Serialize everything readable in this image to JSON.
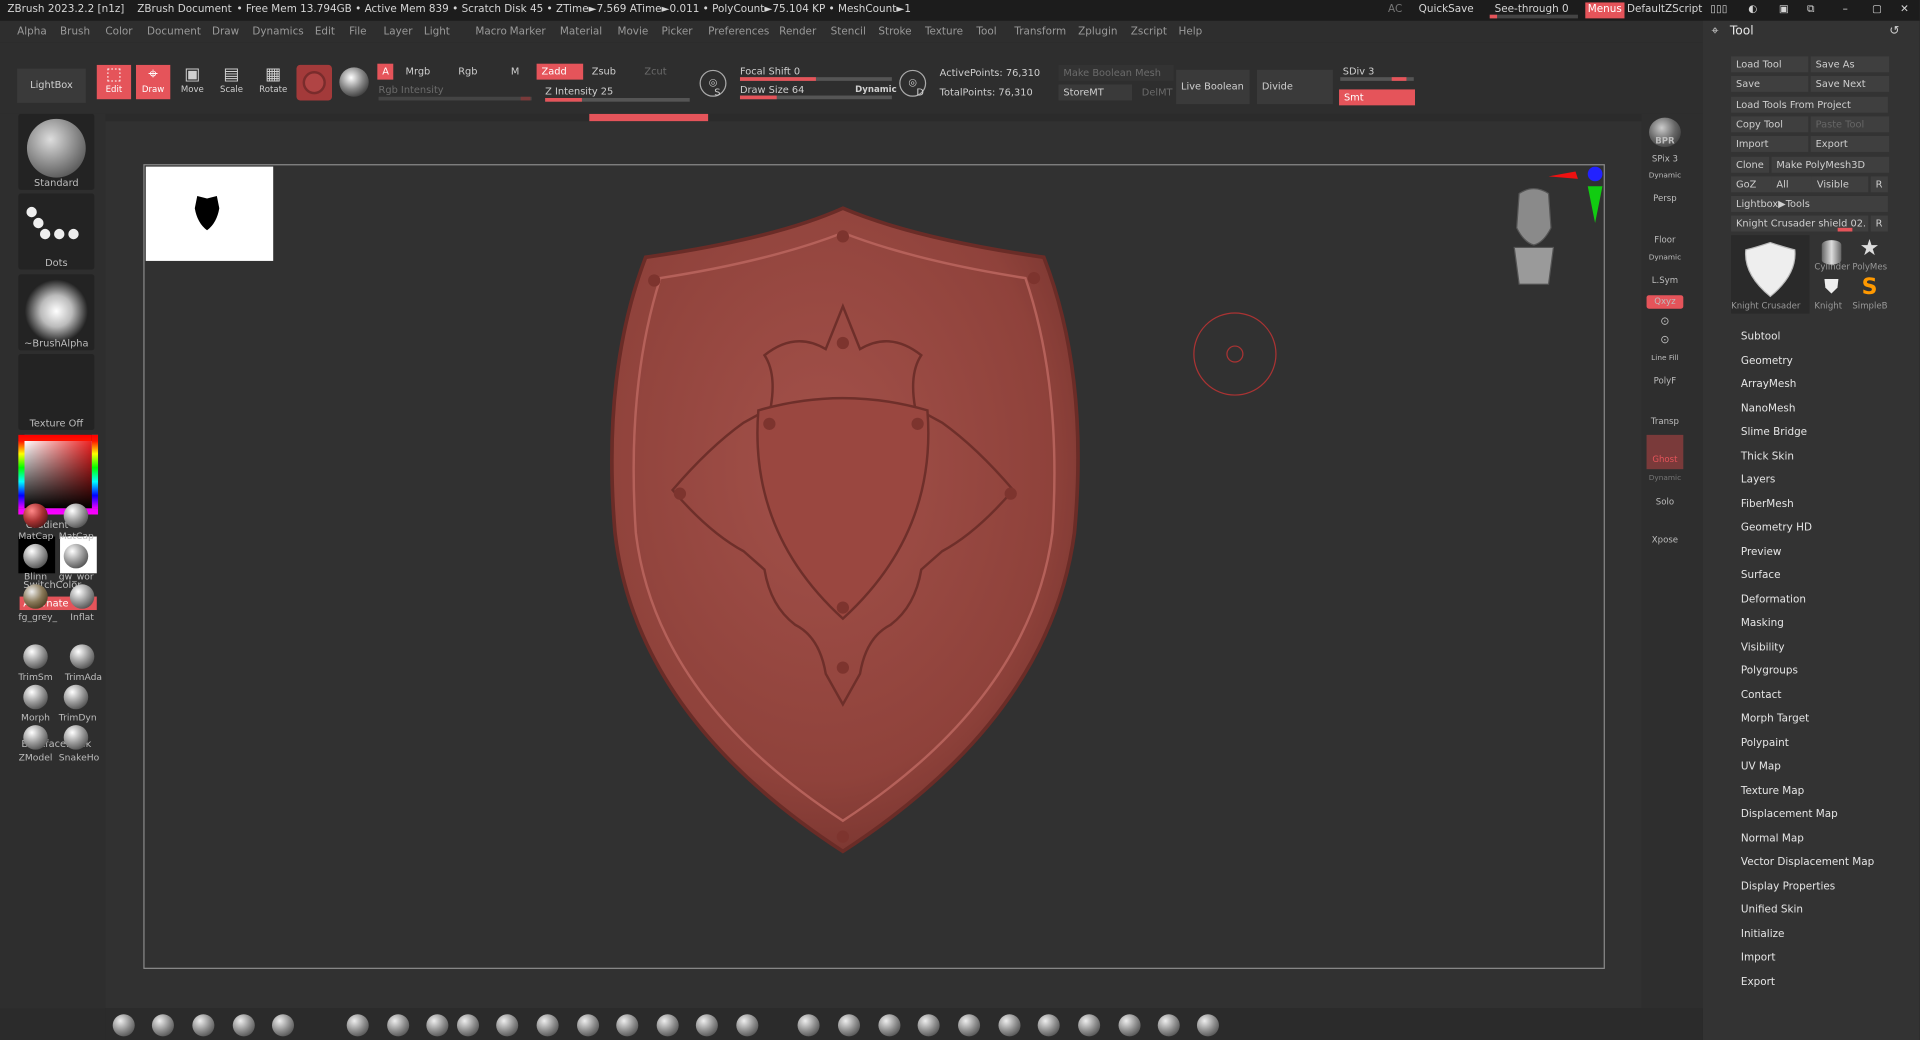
{
  "titlebar": {
    "app": "ZBrush 2023.2.2 [n1z]",
    "doc": "ZBrush Document",
    "stats": "• Free Mem 13.794GB • Active Mem 839 • Scratch Disk 45 • ZTime►7.569 ATime►0.011 • PolyCount►75.104 KP • MeshCount►1",
    "ac": "AC",
    "quicksave": "QuickSave",
    "seethrough": "See-through  0",
    "seethrough_value": 0,
    "menus": "Menus",
    "zscript": "DefaultZScript"
  },
  "menu": [
    "Alpha",
    "Brush",
    "Color",
    "Document",
    "Draw",
    "Dynamics",
    "Edit",
    "File",
    "Layer",
    "Light",
    "Macro",
    "Marker",
    "Material",
    "Movie",
    "Picker",
    "Preferences",
    "Render",
    "Stencil",
    "Stroke",
    "Texture",
    "Tool",
    "Transform",
    "Zplugin",
    "Zscript",
    "Help"
  ],
  "toolbar": {
    "lightbox": "LightBox",
    "edit": "Edit",
    "draw": "Draw",
    "move": "Move",
    "scale": "Scale",
    "rotate": "Rotate",
    "a": "A",
    "mrgb": "Mrgb",
    "rgb": "Rgb",
    "m": "M",
    "rgb_intensity": "Rgb Intensity",
    "zadd": "Zadd",
    "zsub": "Zsub",
    "zcut": "Zcut",
    "z_intensity": "Z Intensity 25",
    "z_intensity_value": 25,
    "focal_shift": "Focal Shift 0",
    "focal_shift_value": 0,
    "draw_size": "Draw Size 64",
    "draw_size_value": 64,
    "dynamic": "Dynamic",
    "active_points": "ActivePoints: 76,310",
    "total_points": "TotalPoints: 76,310",
    "make_boolean_mesh": "Make Boolean Mesh",
    "storemt": "StoreMT",
    "delmt": "DelMT",
    "live_boolean": "Live Boolean",
    "divide": "Divide",
    "sdiv": "SDiv 3",
    "sdiv_value": 3,
    "smt": "Smt",
    "s_key": "S",
    "d_key": "D"
  },
  "left": {
    "brush": "Standard",
    "stroke": "Dots",
    "alpha": "~BrushAlpha",
    "texture": "Texture Off",
    "gradient": "Gradient",
    "switchcolor": "SwitchColor",
    "alternate": "Alternate",
    "backface": "BackfaceMask",
    "materials": [
      "MatCap",
      "MatCap",
      "Blinn",
      "gw_wor",
      "fg_grey_",
      "Inflat",
      "TrimSm",
      "TrimAda",
      "Morph",
      "TrimDyn",
      "ZModel",
      "SnakeHo"
    ]
  },
  "right": {
    "bpr": "BPR",
    "spix": "SPix 3",
    "spix_value": 3,
    "dynamic": "Dynamic",
    "persp": "Persp",
    "floor": "Floor",
    "dynamic2": "Dynamic",
    "lsym": "L.Sym",
    "xyz": "Qxyz",
    "linefill": "Line Fill",
    "polyf": "PolyF",
    "transp": "Transp",
    "ghost": "Ghost",
    "dynamic3": "Dynamic",
    "solo": "Solo",
    "xpose": "Xpose"
  },
  "tool": {
    "title": "Tool",
    "buttons": [
      "Load Tool",
      "Save As",
      "Save",
      "Save Next",
      "Load Tools From Project",
      "Copy Tool",
      "Paste Tool",
      "Import",
      "Export",
      "Clone",
      "Make PolyMesh3D",
      "GoZ",
      "All",
      "Visible",
      "R",
      "Lightbox▶Tools",
      "Knight Crusader shield 02.",
      "R"
    ],
    "thumbs": [
      "Knight Crusader",
      "Cylinder",
      "PolyMes",
      "Knight",
      "SimpleB"
    ],
    "menu": [
      "Subtool",
      "Geometry",
      "ArrayMesh",
      "NanoMesh",
      "Slime Bridge",
      "Thick Skin",
      "Layers",
      "FiberMesh",
      "Geometry HD",
      "Preview",
      "Surface",
      "Deformation",
      "Masking",
      "Visibility",
      "Polygroups",
      "Contact",
      "Morph Target",
      "Polypaint",
      "UV Map",
      "Texture Map",
      "Displacement Map",
      "Normal Map",
      "Vector Displacement Map",
      "Display Properties",
      "Unified Skin",
      "Initialize",
      "Import",
      "Export"
    ]
  },
  "colors": {
    "accent": "#e5545a",
    "shield": "#9a4740"
  }
}
